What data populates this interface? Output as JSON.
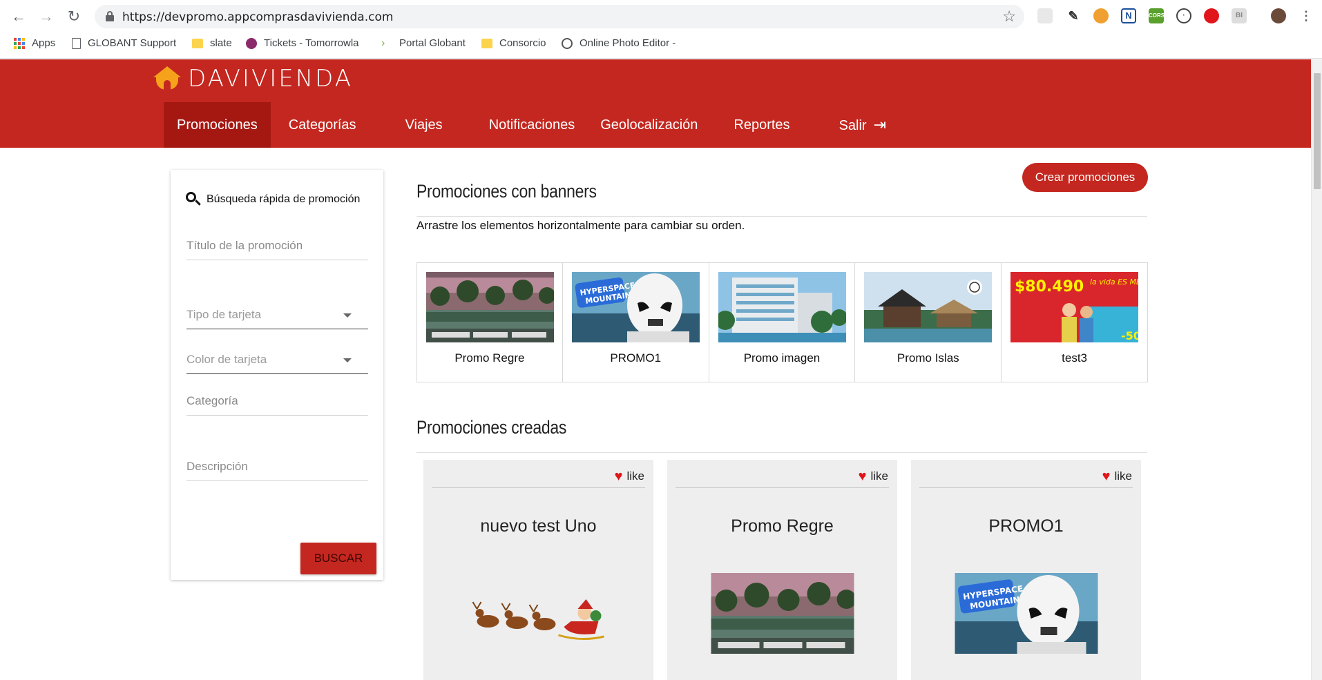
{
  "browser": {
    "url": "https://devpromo.appcomprasdavivienda.com",
    "bookmarks": [
      {
        "label": "Apps",
        "icon": "apps-grid-icon"
      },
      {
        "label": "GLOBANT Support",
        "icon": "page-icon"
      },
      {
        "label": "slate",
        "icon": "folder-icon"
      },
      {
        "label": "Tickets - Tomorrowla",
        "icon": "tickets-icon"
      },
      {
        "label": "Portal Globant",
        "icon": "globant-icon"
      },
      {
        "label": "Consorcio",
        "icon": "folder-icon"
      },
      {
        "label": "Online Photo Editor -",
        "icon": "aperture-icon"
      }
    ]
  },
  "brand": {
    "name": "DAVIVIENDA",
    "primary_color": "#c4271f",
    "accent_color": "#f7a21b"
  },
  "menu": [
    {
      "label": "Promociones",
      "active": true
    },
    {
      "label": "Categorías",
      "active": false
    },
    {
      "label": "Viajes",
      "active": false
    },
    {
      "label": "Notificaciones",
      "active": false
    },
    {
      "label": "Geolocalización",
      "active": false
    },
    {
      "label": "Reportes",
      "active": false
    },
    {
      "label": "Salir",
      "active": false
    }
  ],
  "search": {
    "title": "Búsqueda rápida de promoción",
    "fields": {
      "titulo": "Título de la promoción",
      "tipo": "Tipo de tarjeta",
      "color": "Color de tarjeta",
      "categoria": "Categoría",
      "descripcion": "Descripción"
    },
    "button": "BUSCAR"
  },
  "banners_section": {
    "title": "Promociones con banners",
    "helper": "Arrastre los elementos horizontalmente para cambiar su orden.",
    "create_button": "Crear promociones",
    "items": [
      {
        "label": "Promo Regre",
        "image": "resort-pool"
      },
      {
        "label": "PROMO1",
        "image": "stormtrooper"
      },
      {
        "label": "Promo imagen",
        "image": "hotel-building"
      },
      {
        "label": "Promo Islas",
        "image": "island-house"
      },
      {
        "label": "test3",
        "image": "travel-ad",
        "ad_price": "$80.490",
        "ad_slogan": "la vida ES MEJOR viajando"
      }
    ]
  },
  "created_section": {
    "title": "Promociones creadas",
    "like_label": "like",
    "cards": [
      {
        "title": "nuevo test Uno",
        "image": "santa-sleigh"
      },
      {
        "title": "Promo Regre",
        "image": "resort-pool"
      },
      {
        "title": "PROMO1",
        "image": "stormtrooper"
      }
    ]
  }
}
